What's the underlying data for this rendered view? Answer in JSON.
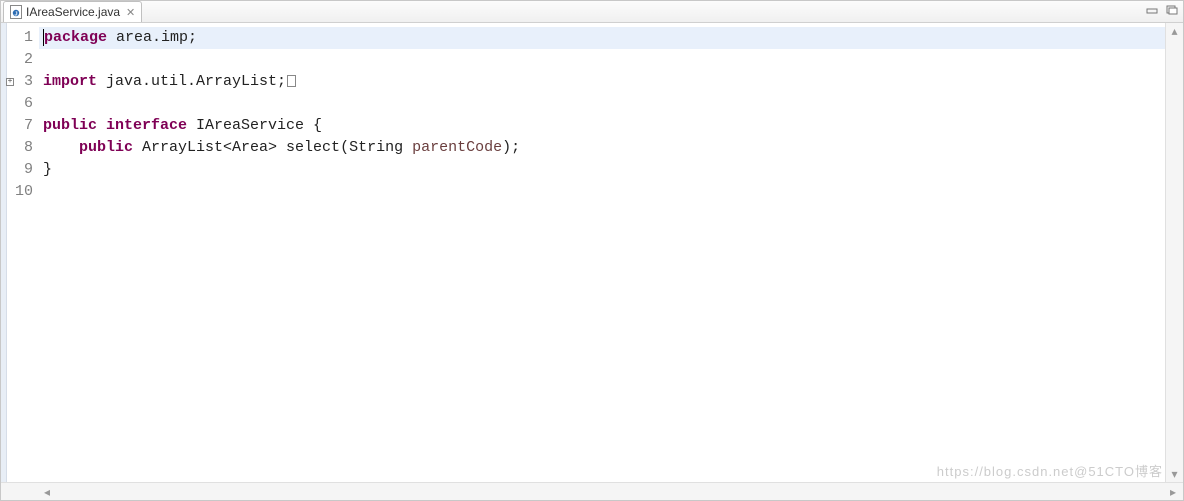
{
  "tab": {
    "filename": "IAreaService.java",
    "close_glyph": "✕"
  },
  "window_controls": {
    "minimize_glyph": "▭",
    "maximize_glyph": "❐"
  },
  "gutter": {
    "lines": [
      "1",
      "2",
      "3",
      "6",
      "7",
      "8",
      "9",
      "10"
    ],
    "folded_line_index": 2
  },
  "code": {
    "lines": [
      {
        "segments": [
          {
            "t": "package ",
            "c": "kw"
          },
          {
            "t": "area.imp;",
            "c": "pkg"
          }
        ],
        "highlight": true,
        "caret": true
      },
      {
        "segments": []
      },
      {
        "segments": [
          {
            "t": "import ",
            "c": "kw"
          },
          {
            "t": "java.util.ArrayList;",
            "c": "pkg"
          }
        ],
        "eolbox": true
      },
      {
        "segments": []
      },
      {
        "segments": [
          {
            "t": "public interface ",
            "c": "kw"
          },
          {
            "t": "IAreaService {",
            "c": "pkg"
          }
        ]
      },
      {
        "segments": [
          {
            "t": "    ",
            "c": "pkg"
          },
          {
            "t": "public ",
            "c": "kw"
          },
          {
            "t": "ArrayList<Area> select(String ",
            "c": "pkg"
          },
          {
            "t": "parentCode",
            "c": "param"
          },
          {
            "t": ");",
            "c": "pkg"
          }
        ]
      },
      {
        "segments": [
          {
            "t": "}",
            "c": "pkg"
          }
        ]
      },
      {
        "segments": []
      }
    ]
  },
  "scroll": {
    "up_glyph": "▴",
    "down_glyph": "▾",
    "left_glyph": "◂",
    "right_glyph": "▸"
  },
  "watermark": "https://blog.csdn.net@51CTO博客"
}
